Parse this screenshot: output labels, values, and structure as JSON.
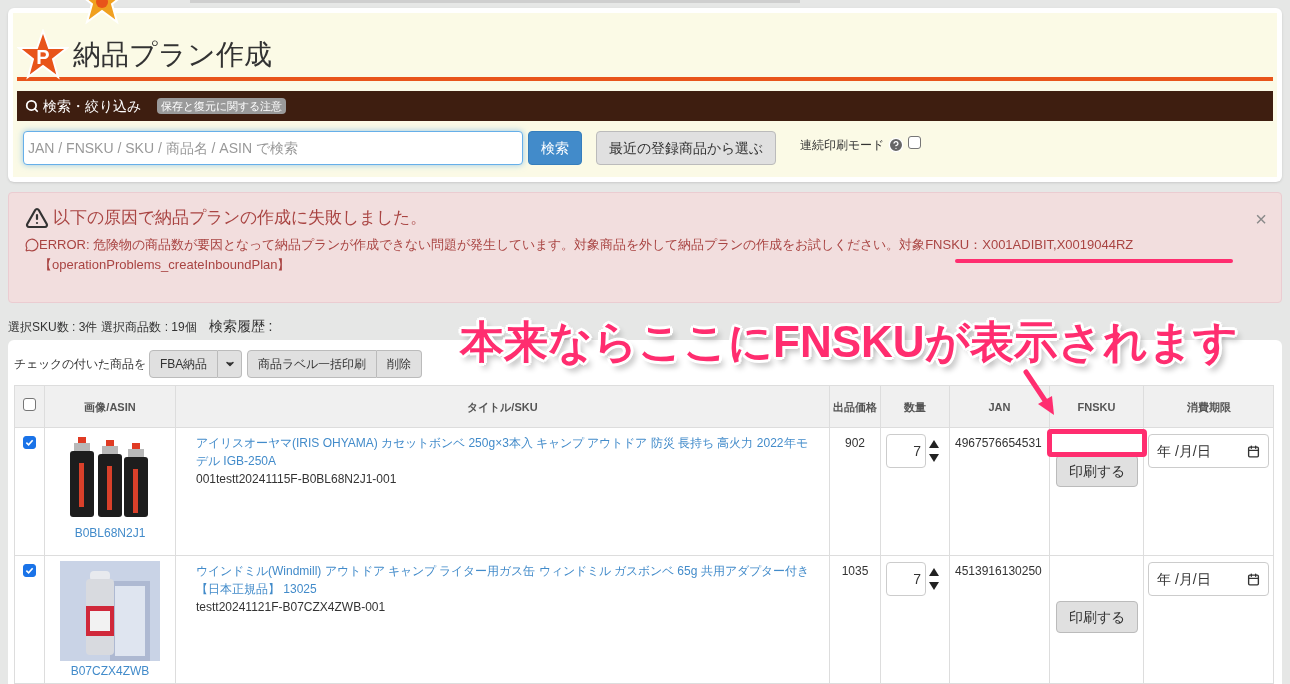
{
  "page": {
    "title": "納品プラン作成",
    "logo_letter": "P"
  },
  "search_panel": {
    "heading": "検索・絞り込み",
    "note_badge": "保存と復元に関する注意",
    "search_field": {
      "placeholder": "JAN / FNSKU / SKU / 商品名 / ASIN で検索"
    },
    "search_button": "検索",
    "recent_button": "最近の登録商品から選ぶ",
    "continuous_print": {
      "label": "連続印刷モード",
      "checked": false
    }
  },
  "error_alert": {
    "title": "以下の原因で納品プランの作成に失敗しました。",
    "message": "ERROR: 危険物の商品数が要因となって納品プランが作成できない問題が発生しています。対象商品を外して納品プランの作成をお試しください。",
    "target_fnsku": "対象FNSKU：X001ADIBIT,X0019044RZ",
    "code": "【operationProblems_createInboundPlan】",
    "close": "×"
  },
  "summary": {
    "sku_count": "選択SKU数 : 3件",
    "item_count": "選択商品数 : 19個",
    "history": "検索履歴 :"
  },
  "toolbar": {
    "label": "チェックの付いた商品を",
    "fba_button": "FBA納品",
    "label_print_button": "商品ラベル一括印刷",
    "delete_button": "削除"
  },
  "table": {
    "select_all": {
      "checked": false
    },
    "columns": [
      "画像/ASIN",
      "タイトル/SKU",
      "出品価格",
      "数量",
      "JAN",
      "FNSKU",
      "消費期限"
    ],
    "rows": [
      {
        "checked": true,
        "asin": "B0BL68N2J1",
        "title": "アイリスオーヤマ(IRIS OHYAMA) カセットボンベ 250g×3本入 キャンプ アウトドア 防災 長持ち 高火力 2022年モデル IGB-250A",
        "sku": "001testt20241115F-B0BL68N2J1-001",
        "price": "902",
        "quantity": "7",
        "jan": "4967576654531",
        "fnsku_highlighted": true,
        "print_button": "印刷する",
        "date_placeholder": "年 /月/日"
      },
      {
        "checked": true,
        "asin": "B07CZX4ZWB",
        "title": "ウインドミル(Windmill) アウトドア キャンプ ライター用ガス缶 ウィンドミル ガスボンベ 65g 共用アダプター付き【日本正規品】 13025",
        "sku": "testt20241121F-B07CZX4ZWB-001",
        "price": "1035",
        "quantity": "7",
        "jan": "4513916130250",
        "fnsku_highlighted": false,
        "print_button": "印刷する",
        "date_placeholder": "年 /月/日"
      }
    ]
  },
  "annotation": {
    "text": "本来ならここにFNSKUが表示されます"
  }
}
